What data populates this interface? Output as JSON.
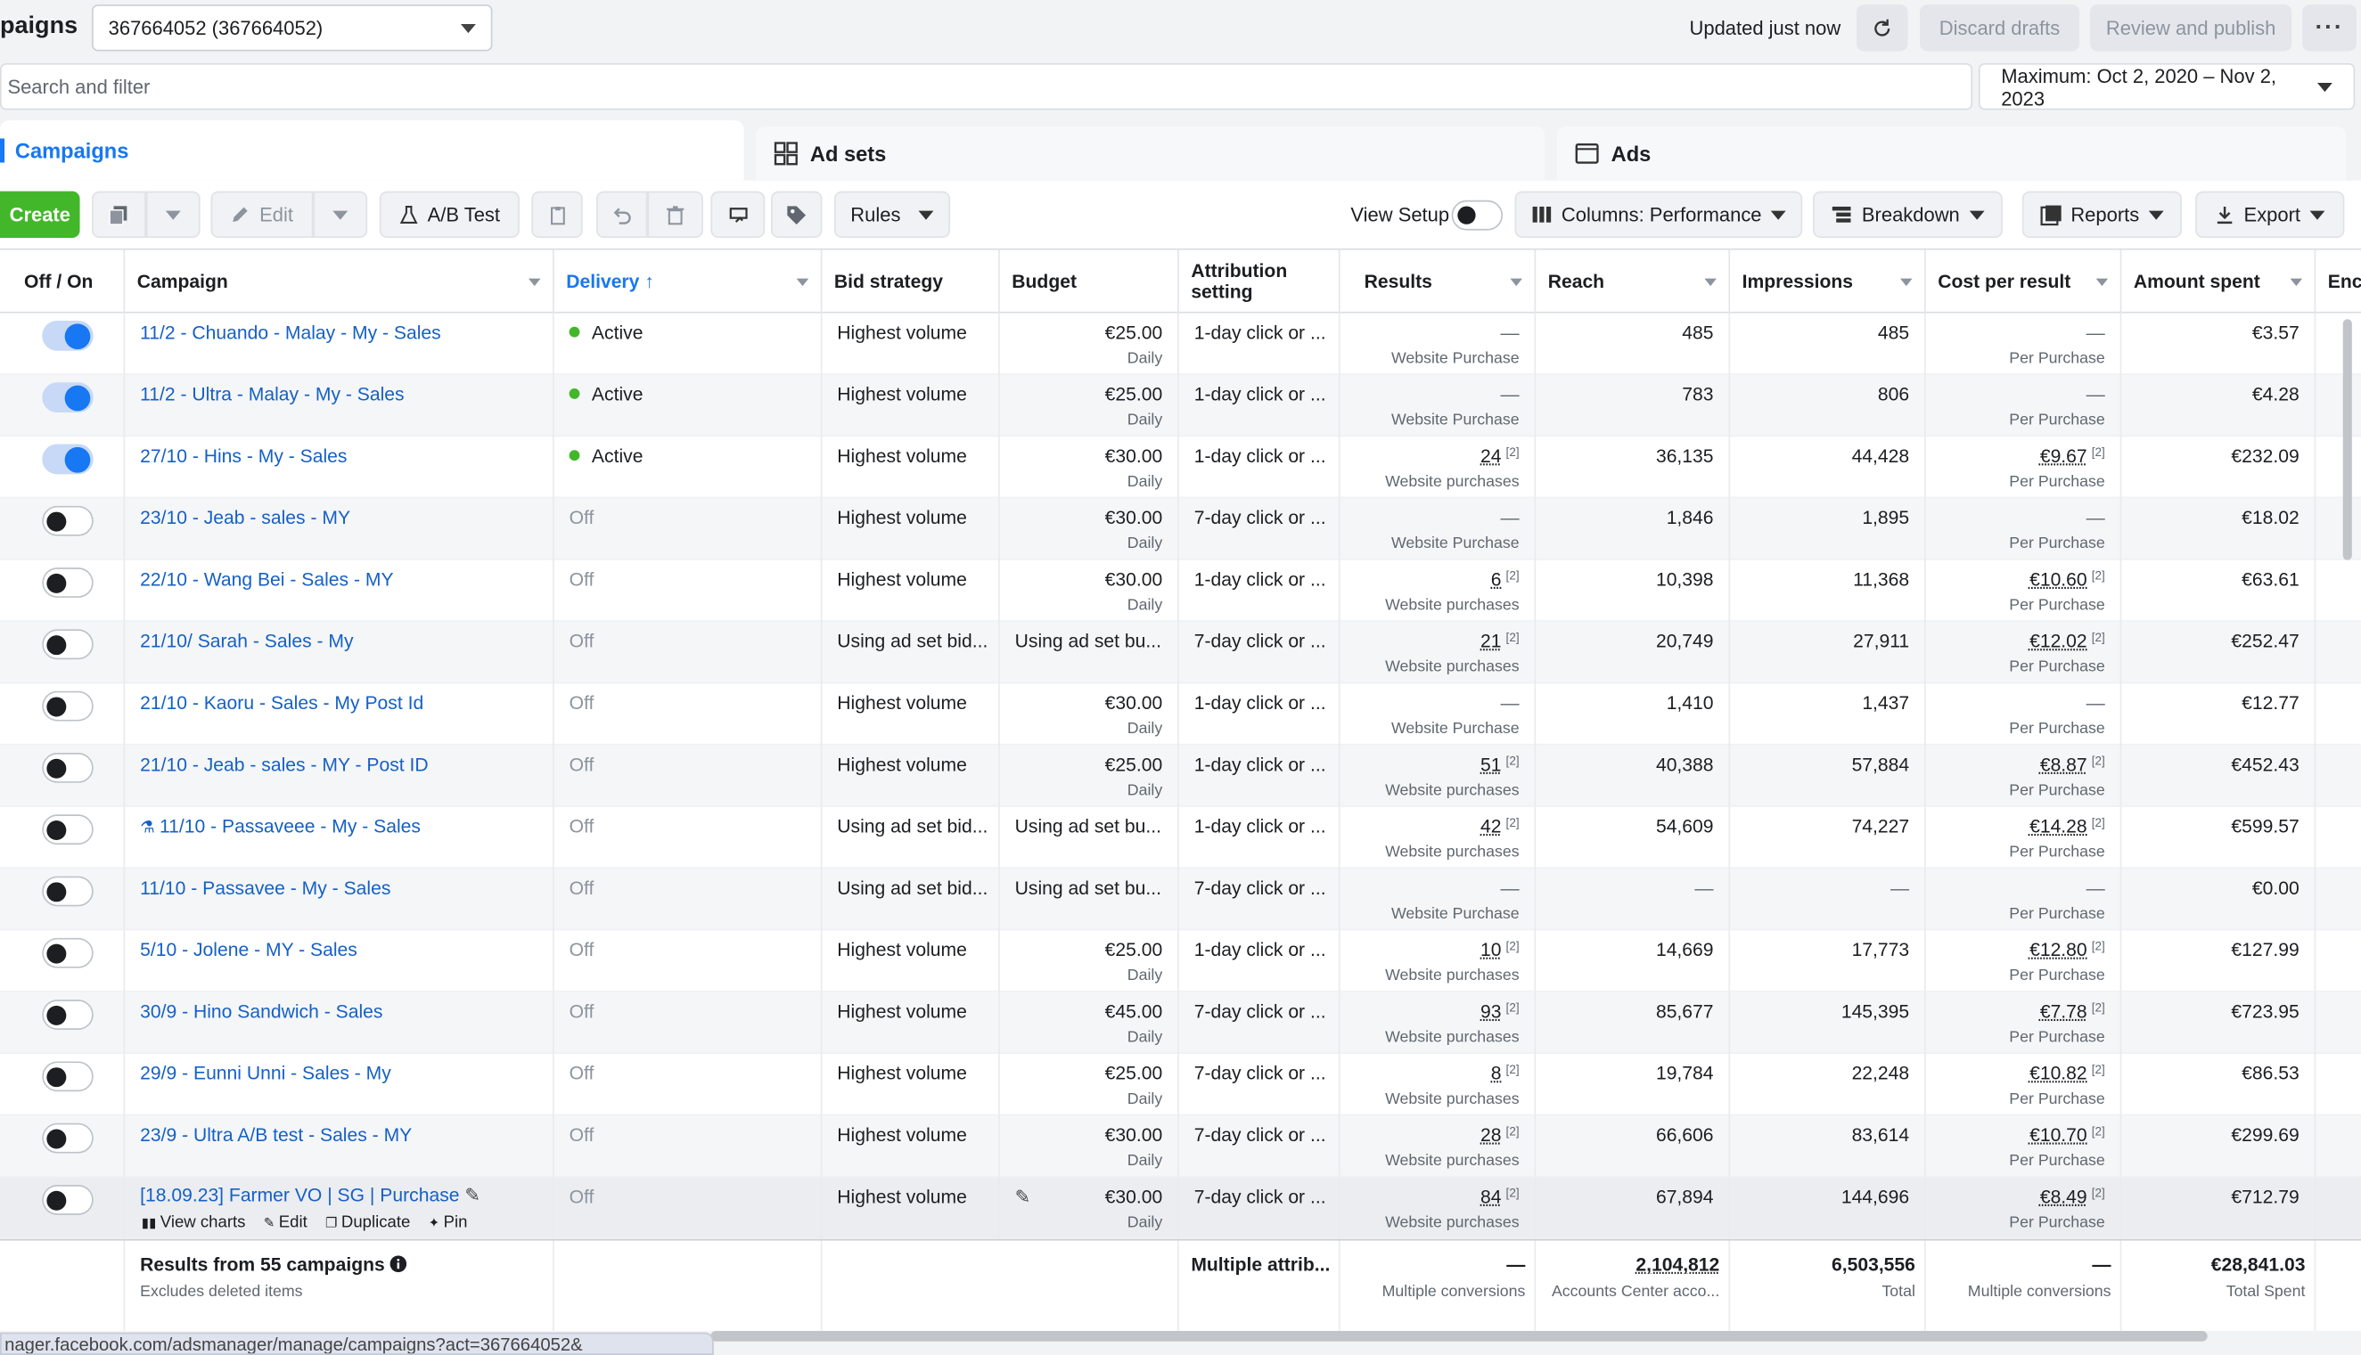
{
  "header": {
    "title": "paigns",
    "account": "367664052 (367664052)",
    "updated": "Updated just now",
    "discard": "Discard drafts",
    "review": "Review and publish",
    "more": "···"
  },
  "search": {
    "placeholder": "Search and filter"
  },
  "date_range": "Maximum: Oct 2, 2020 – Nov 2, 2023",
  "tabs": [
    {
      "label": "Campaigns",
      "icon": "folder-icon"
    },
    {
      "label": "Ad sets",
      "icon": "grid-icon"
    },
    {
      "label": "Ads",
      "icon": "ad-window-icon"
    }
  ],
  "toolbar": {
    "create": "Create",
    "edit": "Edit",
    "ab_test": "A/B Test",
    "rules": "Rules",
    "view_setup": "View Setup",
    "columns": "Columns: Performance",
    "breakdown": "Breakdown",
    "reports": "Reports",
    "export": "Export"
  },
  "columns": {
    "off_on": "Off / On",
    "campaign": "Campaign",
    "delivery": "Delivery ↑",
    "bid_strategy": "Bid strategy",
    "budget": "Budget",
    "attribution": "Attribution setting",
    "results": "Results",
    "reach": "Reach",
    "impressions": "Impressions",
    "cost_per_result": "Cost per result",
    "amount_spent": "Amount spent",
    "ends": "Enc"
  },
  "rows": [
    {
      "on": true,
      "name": "11/2 - Chuando - Malay - My - Sales",
      "delivery": "Active",
      "bid": "Highest volume",
      "budget": "€25.00",
      "budget_sub": "Daily",
      "attr": "1-day click or ...",
      "results": "—",
      "results_sub": "Website Purchase",
      "reach": "485",
      "impr": "485",
      "cpr": "—",
      "cpr_sub": "Per Purchase",
      "spent": "€3.57"
    },
    {
      "on": true,
      "name": "11/2 - Ultra - Malay - My - Sales",
      "delivery": "Active",
      "bid": "Highest volume",
      "budget": "€25.00",
      "budget_sub": "Daily",
      "attr": "1-day click or ...",
      "results": "—",
      "results_sub": "Website Purchase",
      "reach": "783",
      "impr": "806",
      "cpr": "—",
      "cpr_sub": "Per Purchase",
      "spent": "€4.28"
    },
    {
      "on": true,
      "name": "27/10 - Hins - My - Sales",
      "delivery": "Active",
      "bid": "Highest volume",
      "budget": "€30.00",
      "budget_sub": "Daily",
      "attr": "1-day click or ...",
      "results": "24",
      "results_sub": "Website purchases",
      "reach": "36,135",
      "impr": "44,428",
      "cpr": "€9.67",
      "cpr_sub": "Per Purchase",
      "spent": "€232.09"
    },
    {
      "on": false,
      "name": "23/10 - Jeab - sales - MY",
      "delivery": "Off",
      "bid": "Highest volume",
      "budget": "€30.00",
      "budget_sub": "Daily",
      "attr": "7-day click or ...",
      "results": "—",
      "results_sub": "Website Purchase",
      "reach": "1,846",
      "impr": "1,895",
      "cpr": "—",
      "cpr_sub": "Per Purchase",
      "spent": "€18.02"
    },
    {
      "on": false,
      "name": "22/10 - Wang Bei - Sales - MY",
      "delivery": "Off",
      "bid": "Highest volume",
      "budget": "€30.00",
      "budget_sub": "Daily",
      "attr": "1-day click or ...",
      "results": "6",
      "results_sub": "Website purchases",
      "reach": "10,398",
      "impr": "11,368",
      "cpr": "€10.60",
      "cpr_sub": "Per Purchase",
      "spent": "€63.61"
    },
    {
      "on": false,
      "name": "21/10/ Sarah - Sales - My",
      "delivery": "Off",
      "bid": "Using ad set bid...",
      "budget": "Using ad set bu...",
      "budget_sub": "",
      "attr": "7-day click or ...",
      "results": "21",
      "results_sub": "Website purchases",
      "reach": "20,749",
      "impr": "27,911",
      "cpr": "€12.02",
      "cpr_sub": "Per Purchase",
      "spent": "€252.47"
    },
    {
      "on": false,
      "name": "21/10 - Kaoru - Sales - My Post Id",
      "delivery": "Off",
      "bid": "Highest volume",
      "budget": "€30.00",
      "budget_sub": "Daily",
      "attr": "1-day click or ...",
      "results": "—",
      "results_sub": "Website Purchase",
      "reach": "1,410",
      "impr": "1,437",
      "cpr": "—",
      "cpr_sub": "Per Purchase",
      "spent": "€12.77"
    },
    {
      "on": false,
      "name": "21/10 - Jeab - sales - MY - Post ID",
      "delivery": "Off",
      "bid": "Highest volume",
      "budget": "€25.00",
      "budget_sub": "Daily",
      "attr": "1-day click or ...",
      "results": "51",
      "results_sub": "Website purchases",
      "reach": "40,388",
      "impr": "57,884",
      "cpr": "€8.87",
      "cpr_sub": "Per Purchase",
      "spent": "€452.43"
    },
    {
      "on": false,
      "name": "11/10 - Passaveee - My - Sales",
      "flask": true,
      "delivery": "Off",
      "bid": "Using ad set bid...",
      "budget": "Using ad set bu...",
      "budget_sub": "",
      "attr": "1-day click or ...",
      "results": "42",
      "results_sub": "Website purchases",
      "reach": "54,609",
      "impr": "74,227",
      "cpr": "€14.28",
      "cpr_sub": "Per Purchase",
      "spent": "€599.57"
    },
    {
      "on": false,
      "name": "11/10 - Passavee - My - Sales",
      "delivery": "Off",
      "bid": "Using ad set bid...",
      "budget": "Using ad set bu...",
      "budget_sub": "",
      "attr": "7-day click or ...",
      "results": "—",
      "results_sub": "Website Purchase",
      "reach": "—",
      "impr": "—",
      "cpr": "—",
      "cpr_sub": "Per Purchase",
      "spent": "€0.00"
    },
    {
      "on": false,
      "name": "5/10 - Jolene - MY - Sales",
      "delivery": "Off",
      "bid": "Highest volume",
      "budget": "€25.00",
      "budget_sub": "Daily",
      "attr": "1-day click or ...",
      "results": "10",
      "results_sub": "Website purchases",
      "reach": "14,669",
      "impr": "17,773",
      "cpr": "€12.80",
      "cpr_sub": "Per Purchase",
      "spent": "€127.99"
    },
    {
      "on": false,
      "name": "30/9 - Hino Sandwich - Sales",
      "delivery": "Off",
      "bid": "Highest volume",
      "budget": "€45.00",
      "budget_sub": "Daily",
      "attr": "7-day click or ...",
      "results": "93",
      "results_sub": "Website purchases",
      "reach": "85,677",
      "impr": "145,395",
      "cpr": "€7.78",
      "cpr_sub": "Per Purchase",
      "spent": "€723.95"
    },
    {
      "on": false,
      "name": "29/9 - Eunni Unni - Sales - My",
      "delivery": "Off",
      "bid": "Highest volume",
      "budget": "€25.00",
      "budget_sub": "Daily",
      "attr": "7-day click or ...",
      "results": "8",
      "results_sub": "Website purchases",
      "reach": "19,784",
      "impr": "22,248",
      "cpr": "€10.82",
      "cpr_sub": "Per Purchase",
      "spent": "€86.53"
    },
    {
      "on": false,
      "name": "23/9 - Ultra A/B test - Sales - MY",
      "delivery": "Off",
      "bid": "Highest volume",
      "budget": "€30.00",
      "budget_sub": "Daily",
      "attr": "7-day click or ...",
      "results": "28",
      "results_sub": "Website purchases",
      "reach": "66,606",
      "impr": "83,614",
      "cpr": "€10.70",
      "cpr_sub": "Per Purchase",
      "spent": "€299.69"
    },
    {
      "on": false,
      "name": "[18.09.23] Farmer VO | SG | Purchase",
      "hover": true,
      "delivery": "Off",
      "bid": "Highest volume",
      "budget": "€30.00",
      "budget_sub": "Daily",
      "attr": "7-day click or ...",
      "results": "84",
      "results_sub": "Website purchases",
      "reach": "67,894",
      "impr": "144,696",
      "cpr": "€8.49",
      "cpr_sub": "Per Purchase",
      "spent": "€712.79"
    }
  ],
  "row_actions": {
    "view_charts": "View charts",
    "edit": "Edit",
    "duplicate": "Duplicate",
    "pin": "Pin"
  },
  "sup_mark": "[2]",
  "footer": {
    "title": "Results from 55 campaigns",
    "sub": "Excludes deleted items",
    "attr": "Multiple attrib...",
    "results": "—",
    "results_sub": "Multiple conversions",
    "reach": "2,104,812",
    "reach_sub": "Accounts Center acco...",
    "impr": "6,503,556",
    "impr_sub": "Total",
    "cpr": "—",
    "cpr_sub": "Multiple conversions",
    "spent": "€28,841.03",
    "spent_sub": "Total Spent"
  },
  "status_url": "nager.facebook.com/adsmanager/manage/campaigns?act=367664052&"
}
